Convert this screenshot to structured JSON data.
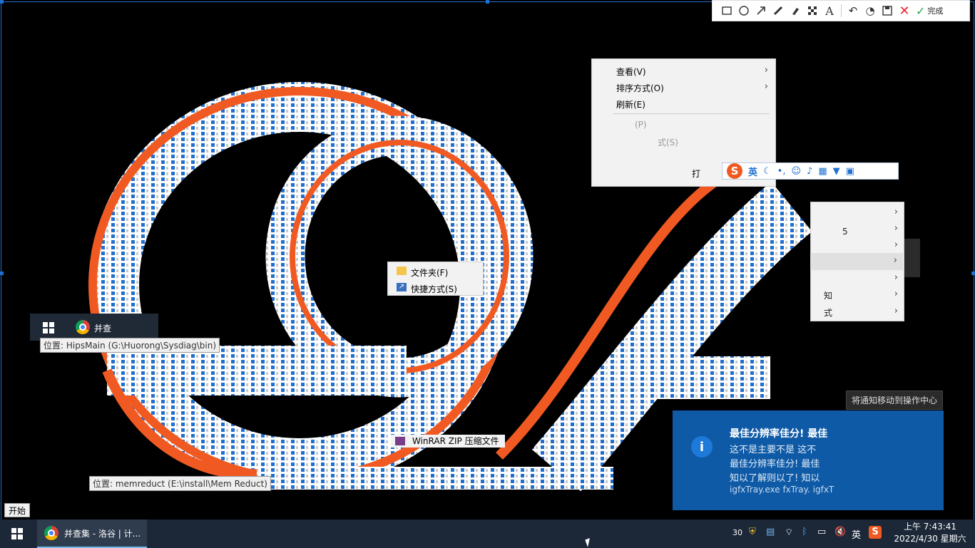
{
  "screenshot_tool": {
    "tools": [
      "rectangle-icon",
      "ellipse-icon",
      "arrow-icon",
      "pen-icon",
      "marker-icon",
      "mosaic-icon",
      "text-icon",
      "undo-icon",
      "palette-icon",
      "save-icon",
      "cancel-icon"
    ],
    "text_tool_label": "A",
    "done_label": "完成"
  },
  "context_menu": {
    "view": "查看(V)",
    "sort": "排序方式(O)",
    "refresh": "刷新(E)",
    "paste_fragment": "(P)",
    "paste_shortcut_fragment": "式(S)",
    "open_fragment": "打"
  },
  "submenu_fragments": {
    "item_a": "5",
    "item_b": "知",
    "item_c": "式"
  },
  "new_menu": {
    "folder": "文件夹(F)",
    "shortcut": "快捷方式(S)",
    "winrar": "WinRAR ZIP 压缩文件"
  },
  "ime": {
    "mode": "英",
    "logo": "S"
  },
  "ghost_taskbar": {
    "app_fragment": "并查"
  },
  "tooltips": {
    "hipsmain": "位置: HipsMain (G:\\Huorong\\Sysdiag\\bin)",
    "memreduct": "位置: memreduct (E:\\install\\Mem Reduct)"
  },
  "notification": {
    "hint": "将通知移动到操作中心",
    "title": "最佳分辨率佳分! 最佳",
    "line1": "这不是主要不是 这不",
    "line2": "最佳分辨率佳分! 最佳",
    "line3": "知以了解则以了! 知以",
    "source": "igfxTray.exe fxTray. igfxT"
  },
  "start_tip": "开始",
  "taskbar": {
    "app_label": "并查集 - 洛谷 | 计...",
    "tray_count": "30",
    "ime": "英",
    "time": "上午 7:43:41",
    "date": "2022/4/30 星期六"
  },
  "colors": {
    "accent": "#1e6fd0",
    "sogou": "#f05a22",
    "taskbar": "#1c2838",
    "notification": "#0f5aa6"
  }
}
